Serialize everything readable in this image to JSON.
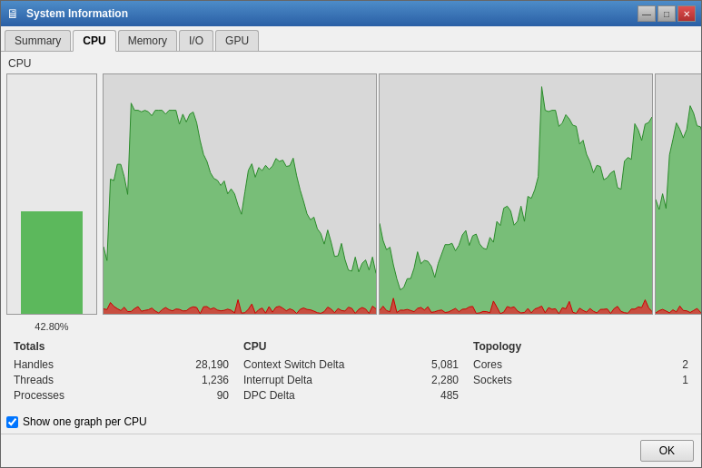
{
  "window": {
    "title": "System Information",
    "icon": "ℹ"
  },
  "tabs": [
    {
      "label": "Summary",
      "active": false
    },
    {
      "label": "CPU",
      "active": true
    },
    {
      "label": "Memory",
      "active": false
    },
    {
      "label": "I/O",
      "active": false
    },
    {
      "label": "GPU",
      "active": false
    }
  ],
  "cpu_label": "CPU",
  "cpu_usage_percent": "42.80%",
  "cpu_usage_value": 42.8,
  "totals": {
    "title": "Totals",
    "rows": [
      {
        "label": "Handles",
        "value": "28,190"
      },
      {
        "label": "Threads",
        "value": "1,236"
      },
      {
        "label": "Processes",
        "value": "90"
      }
    ]
  },
  "cpu_stats": {
    "title": "CPU",
    "rows": [
      {
        "label": "Context Switch Delta",
        "value": "5,081"
      },
      {
        "label": "Interrupt Delta",
        "value": "2,280"
      },
      {
        "label": "DPC Delta",
        "value": "485"
      }
    ]
  },
  "topology": {
    "title": "Topology",
    "rows": [
      {
        "label": "Cores",
        "value": "2"
      },
      {
        "label": "Sockets",
        "value": "1"
      }
    ]
  },
  "checkbox": {
    "label": "Show one graph per CPU",
    "checked": true
  },
  "footer": {
    "ok_label": "OK"
  },
  "title_buttons": {
    "minimize": "—",
    "maximize": "□",
    "close": "✕"
  }
}
